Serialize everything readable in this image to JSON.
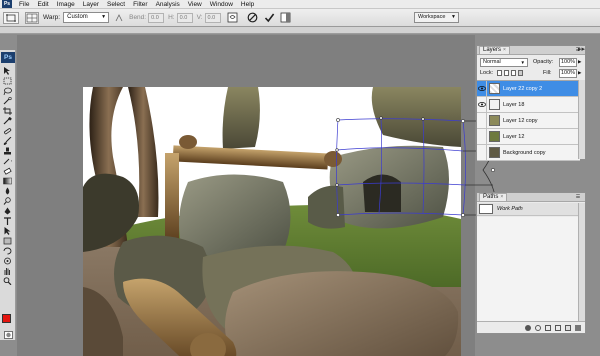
{
  "menubar": {
    "app_badge": "Ps",
    "items": [
      "File",
      "Edit",
      "Image",
      "Layer",
      "Select",
      "Filter",
      "Analysis",
      "View",
      "Window",
      "Help"
    ]
  },
  "options_bar": {
    "warp_label": "Warp:",
    "warp_value": "Custom",
    "bend_label": "Bend:",
    "bend_value": "0.0",
    "h_label": "H:",
    "h_value": "0.0",
    "v_label": "V:",
    "v_value": "0.0",
    "workspace_label": "Workspace"
  },
  "toolbox": {
    "logo": "Ps",
    "foreground_color": "#e4150f",
    "background_color": "#ffffff"
  },
  "layers_panel": {
    "tab_label": "Layers",
    "blend_mode": "Normal",
    "opacity_label": "Opacity:",
    "opacity_value": "100%",
    "lock_label": "Lock:",
    "fill_label": "Fill:",
    "fill_value": "100%",
    "layers": [
      {
        "name": "Layer 22 copy 2",
        "selected": true
      },
      {
        "name": "Layer 18",
        "selected": false
      },
      {
        "name": "Layer 12 copy",
        "selected": false
      },
      {
        "name": "Layer 12",
        "selected": false
      },
      {
        "name": "Background copy",
        "selected": false
      }
    ]
  },
  "paths_panel": {
    "tab_label": "Paths",
    "items": [
      "Work Path"
    ]
  },
  "colors": {
    "selection_blue": "#3f8de5",
    "warp_grid": "#3b3bd0"
  }
}
